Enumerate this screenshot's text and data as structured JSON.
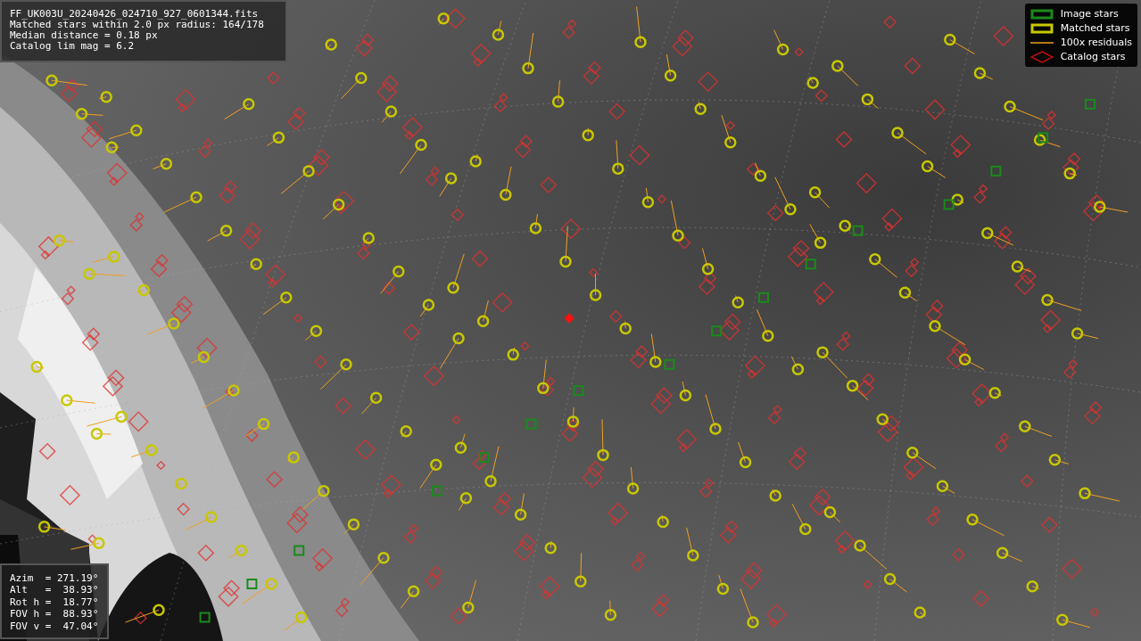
{
  "info": [
    "FF_UK003U_20240426_024710_927_0601344.fits",
    "Matched stars within 2.0 px radius: 164/178",
    "Median distance = 0.18 px",
    "Catalog lim mag = 6.2"
  ],
  "legend": [
    {
      "label": "Image stars"
    },
    {
      "kind": "matched",
      "label": "Matched stars"
    },
    {
      "kind": "residual",
      "label": "100x residuals"
    },
    {
      "kind": "catalog",
      "label": "Catalog stars"
    }
  ],
  "pointing": [
    "Azim  = 271.19°",
    "Alt   =  38.93°",
    "Rot h =  18.77°",
    "FOV h =  88.93°",
    "FOV v =  47.04°"
  ]
}
